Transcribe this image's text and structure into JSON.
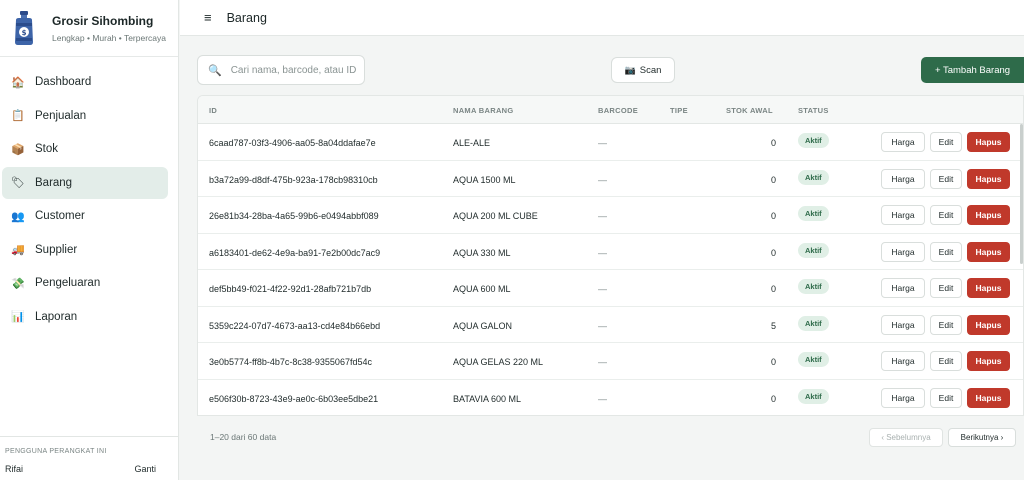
{
  "brand": {
    "title": "Grosir Sihombing",
    "subtitle": "Lengkap • Murah • Terpercaya",
    "logo_icon": "water-jug-icon"
  },
  "sidebar": {
    "items": [
      {
        "label": "Dashboard",
        "icon": "🏠",
        "icon_name": "home-icon",
        "active": false
      },
      {
        "label": "Penjualan",
        "icon": "📋",
        "icon_name": "receipt-icon",
        "active": false
      },
      {
        "label": "Stok",
        "icon": "📦",
        "icon_name": "box-icon",
        "active": false
      },
      {
        "label": "Barang",
        "icon": "🏷",
        "icon_name": "tag-icon",
        "active": true
      },
      {
        "label": "Customer",
        "icon": "👥",
        "icon_name": "users-icon",
        "active": false
      },
      {
        "label": "Supplier",
        "icon": "🚚",
        "icon_name": "truck-icon",
        "active": false
      },
      {
        "label": "Pengeluaran",
        "icon": "💸",
        "icon_name": "money-icon",
        "active": false
      },
      {
        "label": "Laporan",
        "icon": "📊",
        "icon_name": "chart-icon",
        "active": false
      }
    ],
    "footer": {
      "caption": "PENGGUNA PERANGKAT INI",
      "user": "Rifai",
      "switch_label": "Ganti"
    }
  },
  "topbar": {
    "title": "Barang",
    "menu_icon": "≡"
  },
  "toolbar": {
    "search_placeholder": "Cari nama, barcode, atau ID",
    "search_value": "",
    "scan_label": "Scan",
    "add_label": "+ Tambah Barang"
  },
  "table": {
    "headers": {
      "id": "ID",
      "name": "NAMA BARANG",
      "barcode": "BARCODE",
      "tipe": "TIPE",
      "stok": "STOK AWAL",
      "status": "STATUS"
    },
    "rows": [
      {
        "id": "6caad787-03f3-4906-aa05-8a04ddafae7e",
        "name": "ALE-ALE",
        "barcode": "—",
        "tipe": "",
        "stok": "0",
        "status": "Aktif"
      },
      {
        "id": "b3a72a99-d8df-475b-923a-178cb98310cb",
        "name": "AQUA 1500 ML",
        "barcode": "—",
        "tipe": "",
        "stok": "0",
        "status": "Aktif"
      },
      {
        "id": "26e81b34-28ba-4a65-99b6-e0494abbf089",
        "name": "AQUA 200 ML CUBE",
        "barcode": "—",
        "tipe": "",
        "stok": "0",
        "status": "Aktif"
      },
      {
        "id": "a6183401-de62-4e9a-ba91-7e2b00dc7ac9",
        "name": "AQUA 330 ML",
        "barcode": "—",
        "tipe": "",
        "stok": "0",
        "status": "Aktif"
      },
      {
        "id": "def5bb49-f021-4f22-92d1-28afb721b7db",
        "name": "AQUA 600 ML",
        "barcode": "—",
        "tipe": "",
        "stok": "0",
        "status": "Aktif"
      },
      {
        "id": "5359c224-07d7-4673-aa13-cd4e84b66ebd",
        "name": "AQUA GALON",
        "barcode": "—",
        "tipe": "",
        "stok": "5",
        "status": "Aktif"
      },
      {
        "id": "3e0b5774-ff8b-4b7c-8c38-9355067fd54c",
        "name": "AQUA GELAS 220 ML",
        "barcode": "—",
        "tipe": "",
        "stok": "0",
        "status": "Aktif"
      },
      {
        "id": "e506f30b-8723-43e9-ae0c-6b03ee5dbe21",
        "name": "BATAVIA 600 ML",
        "barcode": "—",
        "tipe": "",
        "stok": "0",
        "status": "Aktif"
      }
    ],
    "actions": {
      "harga": "Harga",
      "edit": "Edit",
      "hapus": "Hapus"
    }
  },
  "pagination": {
    "info": "1–20 dari 60 data",
    "prev_label": "‹ Sebelumnya",
    "next_label": "Berikutnya ›"
  },
  "colors": {
    "accent": "#2e6b4a",
    "danger": "#c0392b",
    "badge_bg": "#e0efe6"
  }
}
